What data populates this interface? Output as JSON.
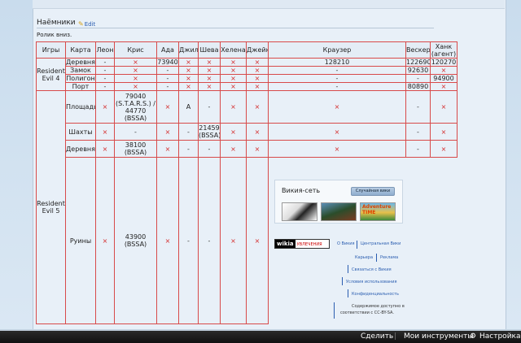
{
  "section": {
    "title": "Наёмники",
    "edit": "Edit",
    "note": "Ролик вниз."
  },
  "table": {
    "headers": [
      "Игры",
      "Карта",
      "Леон",
      "Крис",
      "Ада",
      "Джил",
      "Шева",
      "Хелена",
      "Джейк",
      "Краузер",
      "Вескер",
      "Ханк (агент)"
    ],
    "re4": {
      "game": "Resident Evil 4",
      "rows": [
        {
          "map": "Деревня",
          "cells": [
            "-",
            "×",
            "73940",
            "×",
            "×",
            "×",
            "×",
            "128210",
            "122690",
            "120270"
          ]
        },
        {
          "map": "Замок",
          "cells": [
            "-",
            "×",
            "-",
            "×",
            "×",
            "×",
            "×",
            "-",
            "92630",
            "×"
          ]
        },
        {
          "map": "Полигон",
          "cells": [
            "-",
            "×",
            "-",
            "×",
            "×",
            "×",
            "×",
            "-",
            "-",
            "94900"
          ]
        },
        {
          "map": "Порт",
          "cells": [
            "-",
            "×",
            "-",
            "×",
            "×",
            "×",
            "×",
            "-",
            "80890",
            "×"
          ]
        }
      ]
    },
    "re5": {
      "game": "Resident Evil 5",
      "rows": [
        {
          "map": "Площадь",
          "cells": [
            "×",
            "79040 (S.T.A.R.S.) / 44770 (BSSA)",
            "×",
            "A",
            "-",
            "×",
            "×",
            "×",
            "-",
            "×"
          ]
        },
        {
          "map": "Шахты",
          "cells": [
            "×",
            "-",
            "×",
            "-",
            "21459 (BSSA)",
            "×",
            "×",
            "×",
            "-",
            "×"
          ]
        },
        {
          "map": "Деревня",
          "cells": [
            "×",
            "38100 (BSSA)",
            "×",
            "-",
            "-",
            "×",
            "×",
            "×",
            "-",
            "×"
          ]
        },
        {
          "map": "Руины",
          "cells": [
            "×",
            "43900 (BSSA)",
            "×",
            "-",
            "-",
            "×",
            "×"
          ]
        }
      ]
    }
  },
  "wikia": {
    "title": "Викия-сеть",
    "random": "Случайная вики",
    "logo": "wikia",
    "logo_sub": "УВЛЕЧЕНИЯ",
    "thumb3": "Adventure TIME",
    "links": [
      "О Викия",
      "Центральная Вики",
      "Карьера",
      "Реклама",
      "Связаться с Викия",
      "Условия использования",
      "Конфиденциальность"
    ],
    "license1": "Содержимое доступно в",
    "license2": "соответствии с CC-BY-SA."
  },
  "toolbar": {
    "share": "Сдел",
    "share_full": "Сделить",
    "tools": "Мои инструменты",
    "settings": "Настройка"
  },
  "colors": {
    "grid": "#d84a4a",
    "cross": "#d42b2b",
    "link": "#2a5db0",
    "toolbar": "#111111"
  }
}
